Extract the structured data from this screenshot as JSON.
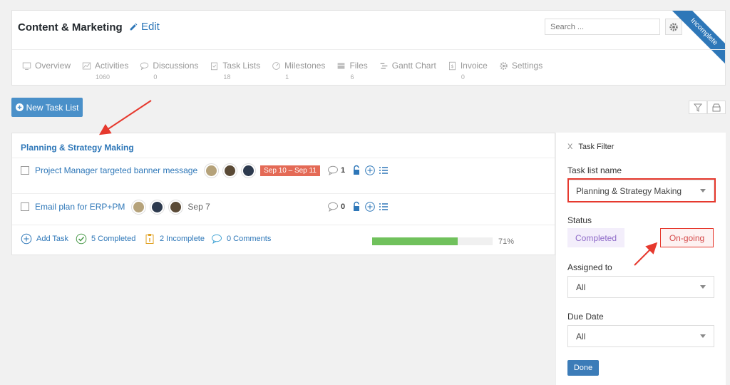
{
  "header": {
    "title": "Content & Marketing",
    "edit_label": "Edit",
    "search_placeholder": "Search ...",
    "ribbon": "Incomplete"
  },
  "tabs": [
    {
      "label": "Overview",
      "count": "",
      "icon": "monitor-icon"
    },
    {
      "label": "Activities",
      "count": "1060",
      "icon": "chart-icon"
    },
    {
      "label": "Discussions",
      "count": "0",
      "icon": "chat-icon"
    },
    {
      "label": "Task Lists",
      "count": "18",
      "icon": "clipboard-icon"
    },
    {
      "label": "Milestones",
      "count": "1",
      "icon": "gauge-icon"
    },
    {
      "label": "Files",
      "count": "6",
      "icon": "files-icon"
    },
    {
      "label": "Gantt Chart",
      "count": "",
      "icon": "gantt-icon"
    },
    {
      "label": "Invoice",
      "count": "0",
      "icon": "invoice-icon"
    },
    {
      "label": "Settings",
      "count": "",
      "icon": "gear-icon"
    }
  ],
  "toolbar": {
    "new_task_list": "New Task List"
  },
  "list": {
    "title": "Planning & Strategy Making",
    "tasks": [
      {
        "name": "Project Manager targeted banner message",
        "date": "Sep 10 – Sep 11",
        "comments": "1"
      },
      {
        "name": "Email plan for ERP+PM",
        "date": "Sep 7",
        "comments": "0"
      }
    ],
    "footer": {
      "add_task": "Add Task",
      "completed": "5 Completed",
      "incomplete": "2 Incomplete",
      "comments": "0 Comments",
      "progress": 71,
      "progress_label": "71%"
    }
  },
  "filter": {
    "close": "X",
    "title": "Task Filter",
    "list_name_label": "Task list name",
    "list_name_value": "Planning & Strategy Making",
    "status_label": "Status",
    "status_completed": "Completed",
    "status_ongoing": "On-going",
    "assigned_label": "Assigned to",
    "assigned_value": "All",
    "due_label": "Due Date",
    "due_value": "All",
    "done": "Done"
  },
  "colors": {
    "accent": "#2e77b8",
    "highlight": "#e6392e",
    "progress": "#70c15c",
    "date_badge": "#e46a56"
  }
}
